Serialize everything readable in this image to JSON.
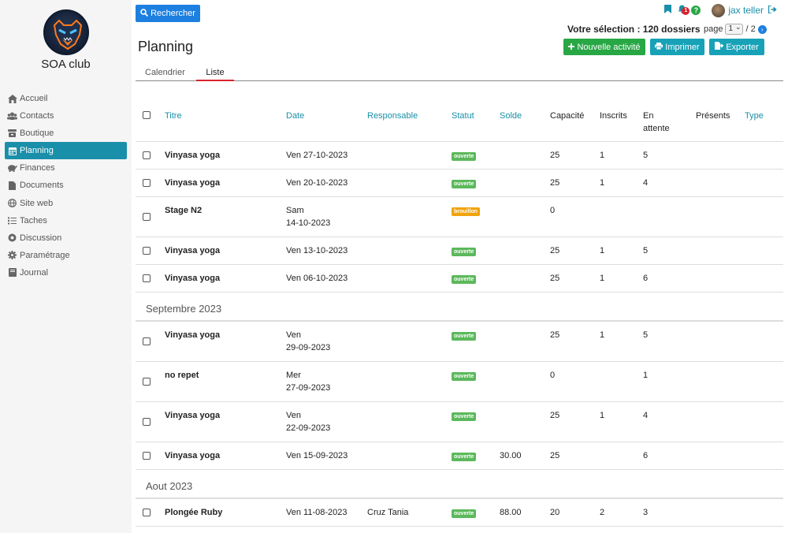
{
  "sidebar": {
    "club_name": "SOA club",
    "items": [
      {
        "label": "Accueil",
        "icon": "home-icon"
      },
      {
        "label": "Contacts",
        "icon": "users-icon"
      },
      {
        "label": "Boutique",
        "icon": "shop-icon"
      },
      {
        "label": "Planning",
        "icon": "calendar-icon",
        "active": true
      },
      {
        "label": "Finances",
        "icon": "piggy-bank-icon"
      },
      {
        "label": "Documents",
        "icon": "file-icon"
      },
      {
        "label": "Site web",
        "icon": "globe-icon"
      },
      {
        "label": "Taches",
        "icon": "tasks-icon"
      },
      {
        "label": "Discussion",
        "icon": "chat-icon"
      },
      {
        "label": "Paramétrage",
        "icon": "gear-icon"
      },
      {
        "label": "Journal",
        "icon": "book-icon"
      }
    ]
  },
  "topbar": {
    "search_label": "Rechercher",
    "notification_count": "1",
    "help_label": "?",
    "user_name": "jax teller"
  },
  "header": {
    "selection": "Votre sélection : 120 dossiers",
    "page_label": "page",
    "page_current": "1",
    "page_total": "/ 2",
    "title": "Planning",
    "new_label": "Nouvelle activité",
    "print_label": "Imprimer",
    "export_label": "Exporter"
  },
  "tabs": {
    "calendar": "Calendrier",
    "list": "Liste"
  },
  "table": {
    "headers": {
      "titre": "Titre",
      "date": "Date",
      "responsable": "Responsable",
      "statut": "Statut",
      "solde": "Solde",
      "capacite": "Capacité",
      "inscrits": "Inscrits",
      "attente_1": "En",
      "attente_2": "attente",
      "presents": "Présents",
      "type": "Type"
    },
    "rows_oct": [
      {
        "titre": "Vinyasa yoga",
        "date1": "Ven 27-10-2023",
        "date2": "",
        "responsable": "",
        "statut": "ouverte",
        "solde": "",
        "capacite": "25",
        "inscrits": "1",
        "attente": "5"
      },
      {
        "titre": "Vinyasa yoga",
        "date1": "Ven 20-10-2023",
        "date2": "",
        "responsable": "",
        "statut": "ouverte",
        "solde": "",
        "capacite": "25",
        "inscrits": "1",
        "attente": "4"
      },
      {
        "titre": "Stage N2",
        "date1": "Sam",
        "date2": "14-10-2023",
        "responsable": "",
        "statut": "brouillon",
        "solde": "",
        "capacite": "0",
        "inscrits": "",
        "attente": ""
      },
      {
        "titre": "Vinyasa yoga",
        "date1": "Ven 13-10-2023",
        "date2": "",
        "responsable": "",
        "statut": "ouverte",
        "solde": "",
        "capacite": "25",
        "inscrits": "1",
        "attente": "5"
      },
      {
        "titre": "Vinyasa yoga",
        "date1": "Ven 06-10-2023",
        "date2": "",
        "responsable": "",
        "statut": "ouverte",
        "solde": "",
        "capacite": "25",
        "inscrits": "1",
        "attente": "6"
      }
    ],
    "group_sep": "Septembre 2023",
    "rows_sep": [
      {
        "titre": "Vinyasa yoga",
        "date1": "Ven",
        "date2": "29-09-2023",
        "responsable": "",
        "statut": "ouverte",
        "solde": "",
        "capacite": "25",
        "inscrits": "1",
        "attente": "5"
      },
      {
        "titre": "no repet",
        "date1": "Mer",
        "date2": "27-09-2023",
        "responsable": "",
        "statut": "ouverte",
        "solde": "",
        "capacite": "0",
        "inscrits": "",
        "attente": "1"
      },
      {
        "titre": "Vinyasa yoga",
        "date1": "Ven",
        "date2": "22-09-2023",
        "responsable": "",
        "statut": "ouverte",
        "solde": "",
        "capacite": "25",
        "inscrits": "1",
        "attente": "4"
      },
      {
        "titre": "Vinyasa yoga",
        "date1": "Ven 15-09-2023",
        "date2": "",
        "responsable": "",
        "statut": "ouverte",
        "solde": "30.00",
        "capacite": "25",
        "inscrits": "",
        "attente": "6"
      }
    ],
    "group_aug": "Aout 2023",
    "rows_aug": [
      {
        "titre": "Plongée Ruby",
        "date1": "Ven 11-08-2023",
        "date2": "",
        "responsable": "Cruz Tania",
        "statut": "ouverte",
        "solde": "88.00",
        "capacite": "20",
        "inscrits": "2",
        "attente": "3"
      }
    ]
  },
  "colors": {
    "accent": "#1a8fa9",
    "primary": "#1d7fe0",
    "success": "#28a745",
    "info": "#17a2b8",
    "status_open": "#5cb85c",
    "status_draft": "#f0a30a",
    "tab_underline": "#d9232d"
  }
}
